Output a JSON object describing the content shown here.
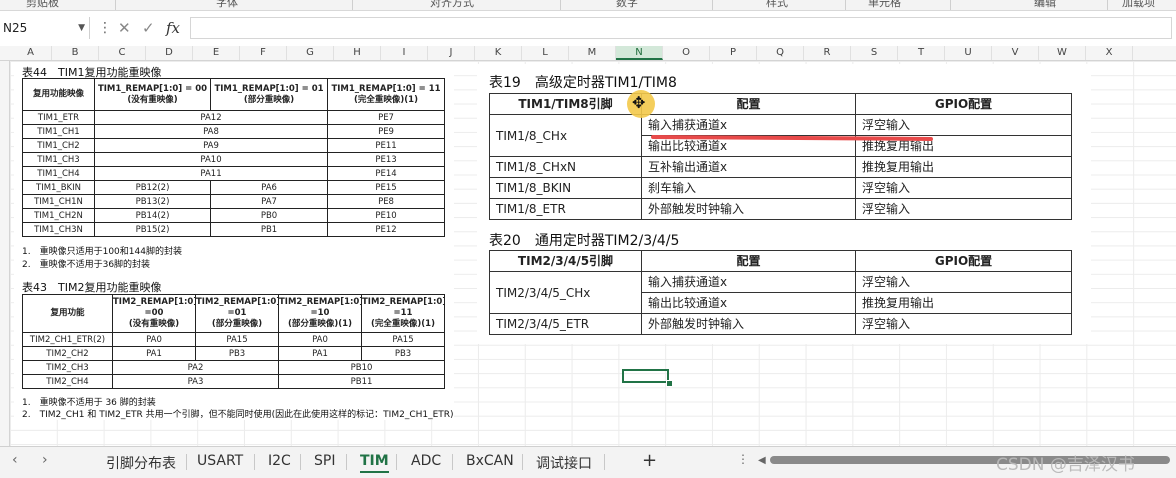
{
  "ribbon": {
    "labels": [
      "剪贴板",
      "字体",
      "对齐方式",
      "数字",
      "样式",
      "单元格",
      "编辑",
      "加载项"
    ]
  },
  "formula_bar": {
    "name_box": "N25",
    "more": "⋮",
    "cancel": "✕",
    "enter": "✓",
    "fx": "fx",
    "value": ""
  },
  "columns": [
    "A",
    "B",
    "C",
    "D",
    "E",
    "F",
    "G",
    "H",
    "I",
    "J",
    "K",
    "L",
    "M",
    "N",
    "O",
    "P",
    "Q",
    "R",
    "S",
    "T",
    "U",
    "V",
    "W",
    "X"
  ],
  "selected_column": "N",
  "table44": {
    "caption": "表44　TIM1复用功能重映像",
    "headers": [
      "复用功能映像",
      "TIM1_REMAP[1:0] = 00\n(没有重映像)",
      "TIM1_REMAP[1:0] = 01\n(部分重映像)",
      "TIM1_REMAP[1:0] = 11\n(完全重映像)(1)"
    ],
    "rows_top": [
      {
        "name": "TIM1_ETR",
        "pin": "PA12",
        "full": "PE7"
      },
      {
        "name": "TIM1_CH1",
        "pin": "PA8",
        "full": "PE9"
      },
      {
        "name": "TIM1_CH2",
        "pin": "PA9",
        "full": "PE11"
      },
      {
        "name": "TIM1_CH3",
        "pin": "PA10",
        "full": "PE13"
      },
      {
        "name": "TIM1_CH4",
        "pin": "PA11",
        "full": "PE14"
      }
    ],
    "rows_bottom": [
      {
        "name": "TIM1_BKIN",
        "none": "PB12(2)",
        "partial": "PA6",
        "full": "PE15"
      },
      {
        "name": "TIM1_CH1N",
        "none": "PB13(2)",
        "partial": "PA7",
        "full": "PE8"
      },
      {
        "name": "TIM1_CH2N",
        "none": "PB14(2)",
        "partial": "PB0",
        "full": "PE10"
      },
      {
        "name": "TIM1_CH3N",
        "none": "PB15(2)",
        "partial": "PB1",
        "full": "PE12"
      }
    ],
    "notes": [
      "1.　重映像只适用于100和144脚的封装",
      "2.　重映像不适用于36脚的封装"
    ]
  },
  "table43": {
    "caption": "表43　TIM2复用功能重映像",
    "headers": [
      "复用功能",
      "TIM2_REMAP[1:0]\n=00\n(没有重映像)",
      "TIM2_REMAP[1:0]\n=01\n(部分重映像)",
      "TIM2_REMAP[1:0]\n=10\n(部分重映像)(1)",
      "TIM2_REMAP[1:0]\n=11\n(完全重映像)(1)"
    ],
    "rows4": [
      {
        "name": "TIM2_CH1_ETR(2)",
        "v": [
          "PA0",
          "PA15",
          "PA0",
          "PA15"
        ]
      },
      {
        "name": "TIM2_CH2",
        "v": [
          "PA1",
          "PB3",
          "PA1",
          "PB3"
        ]
      }
    ],
    "rows2": [
      {
        "name": "TIM2_CH3",
        "v": [
          "PA2",
          "PB10"
        ]
      },
      {
        "name": "TIM2_CH4",
        "v": [
          "PA3",
          "PB11"
        ]
      }
    ],
    "notes": [
      "1.　重映像不适用于 36 脚的封装",
      "2.　TIM2_CH1 和 TIM2_ETR 共用一个引脚，但不能同时使用(因此在此使用这样的标记：TIM2_CH1_ETR)"
    ]
  },
  "table19": {
    "caption": "表19　高级定时器TIM1/TIM8",
    "headers": [
      "TIM1/TIM8引脚",
      "配置",
      "GPIO配置"
    ],
    "rows": [
      {
        "pin": "TIM1/8_CHx",
        "config": "输入捕获通道x",
        "gpio": "浮空输入"
      },
      {
        "pin": "",
        "config": "输出比较通道x",
        "gpio": "推挽复用输出"
      },
      {
        "pin": "TIM1/8_CHxN",
        "config": "互补输出通道x",
        "gpio": "推挽复用输出"
      },
      {
        "pin": "TIM1/8_BKIN",
        "config": "刹车输入",
        "gpio": "浮空输入"
      },
      {
        "pin": "TIM1/8_ETR",
        "config": "外部触发时钟输入",
        "gpio": "浮空输入"
      }
    ]
  },
  "table20": {
    "caption": "表20　通用定时器TIM2/3/4/5",
    "headers": [
      "TIM2/3/4/5引脚",
      "配置",
      "GPIO配置"
    ],
    "rows": [
      {
        "pin": "TIM2/3/4/5_CHx",
        "config": "输入捕获通道x",
        "gpio": "浮空输入"
      },
      {
        "pin": "",
        "config": "输出比较通道x",
        "gpio": "推挽复用输出"
      },
      {
        "pin": "TIM2/3/4/5_ETR",
        "config": "外部触发时钟输入",
        "gpio": "浮空输入"
      }
    ]
  },
  "sheet_tabs": {
    "prev": "‹",
    "next": "›",
    "tabs": [
      "引脚分布表",
      "USART",
      "I2C",
      "SPI",
      "TIM",
      "ADC",
      "BxCAN",
      "调试接口"
    ],
    "active": "TIM",
    "add": "+",
    "more": "⋮"
  },
  "watermark": "CSDN @吉泽汉书",
  "colors": {
    "accent": "#217346",
    "annotation_red": "#e84a4a",
    "cursor_highlight": "#f3c94a"
  }
}
